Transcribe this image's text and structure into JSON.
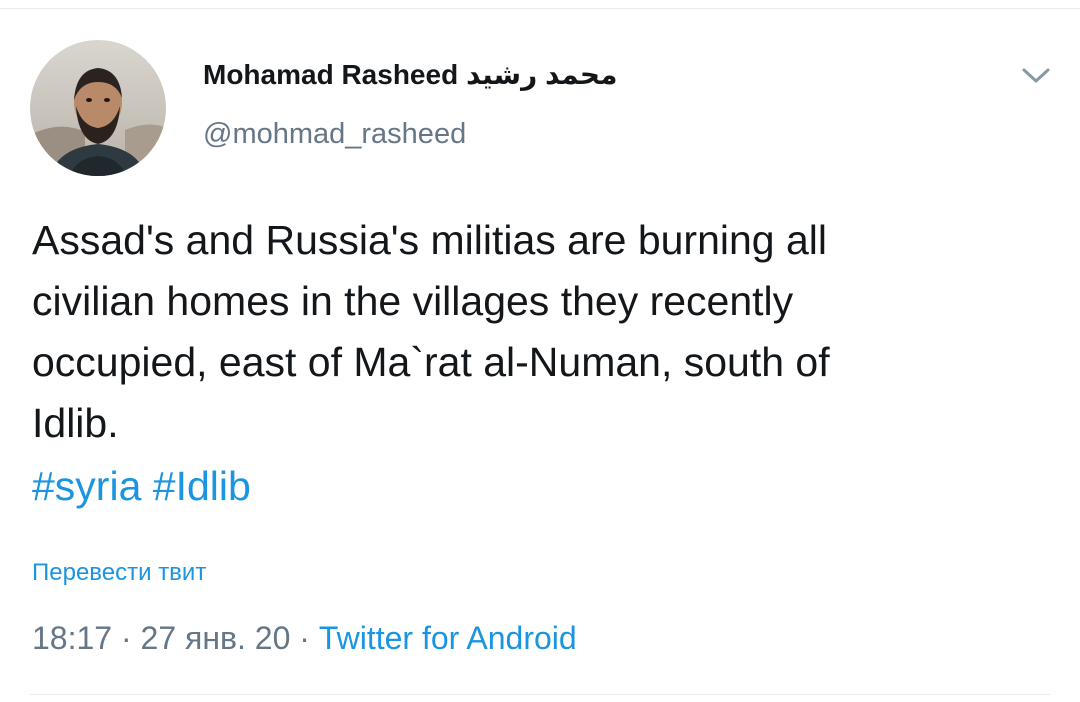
{
  "author": {
    "display_name": "Mohamad Rasheed محمد رشيد",
    "handle": "@mohmad_rasheed"
  },
  "tweet": {
    "text_lines": [
      "Assad's and Russia's militias are burning all",
      "civilian homes in the villages they recently",
      "occupied, east of Ma`rat al-Numan, south of",
      "Idlib."
    ],
    "hashtags": [
      "#syria",
      "#Idlib"
    ],
    "translate_label": "Перевести твит"
  },
  "meta": {
    "time": "18:17",
    "separator": " · ",
    "date": "27 янв. 20",
    "source": "Twitter for Android"
  },
  "icons": {
    "menu": "chevron-down-icon",
    "avatar": "profile-photo"
  },
  "colors": {
    "link": "#1b95e0",
    "secondary": "#657786",
    "text": "#14171a",
    "divider": "#e6ecf0"
  }
}
